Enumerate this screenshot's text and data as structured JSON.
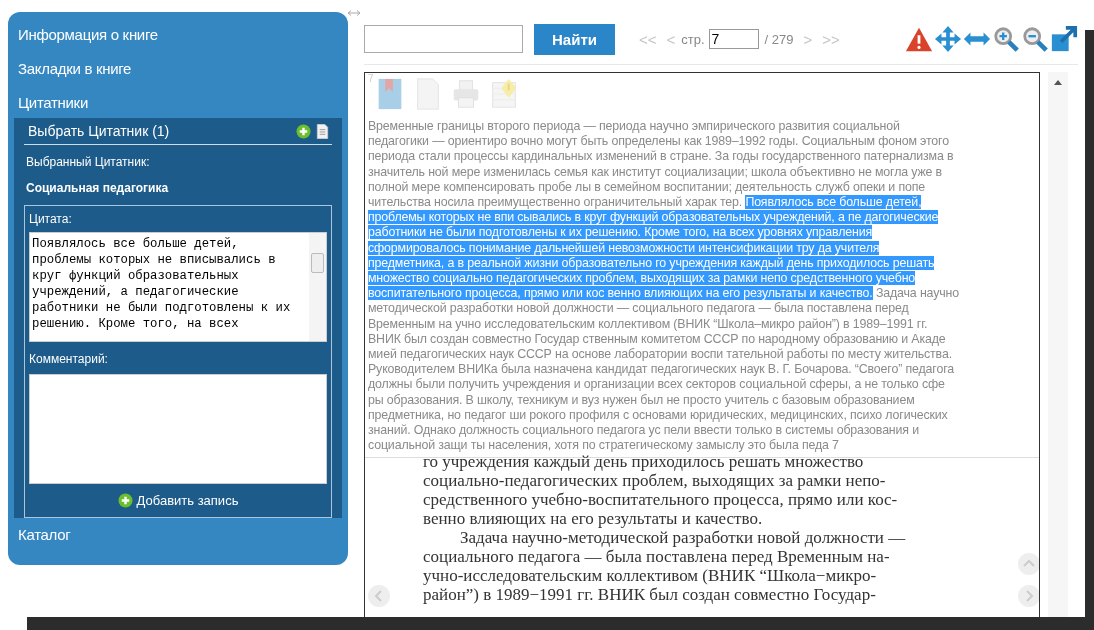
{
  "sidebar": {
    "items": [
      {
        "label": "Информация о книге",
        "expanded": false
      },
      {
        "label": "Закладки в книге",
        "expanded": false
      },
      {
        "label": "Цитатники",
        "expanded": true
      },
      {
        "label": "Каталог",
        "expanded": false
      }
    ],
    "quotebooks": {
      "header": "Выбрать Цитатник (1)",
      "selected_label": "Выбранный Цитатник:",
      "selected_name": "Социальная педагогика",
      "quote_label": "Цитата:",
      "quote_value": "Появлялось все больше детей, проблемы которых не вписывались в круг функций образовательных учреждений, а педагогические работники не были подготовлены к их решению. Кроме того, на всех",
      "comment_label": "Комментарий:",
      "add_button": "Добавить запись"
    }
  },
  "toolbar": {
    "search_button": "Найти",
    "first": "<<",
    "prev": "<",
    "page_label": "стр.",
    "page_value": "7",
    "page_total": "/ 279",
    "next": ">",
    "last": ">>"
  },
  "viewer": {
    "page_number": "7",
    "text_layer": [
      [
        {
          "text": "Временные границы второго периода — периода научно эмпирического развития социальной",
          "selected": false
        }
      ],
      [
        {
          "text": "педагогики — ориентиро вочно могут быть определены как 1989–1992 годы. Социальным фоном этого",
          "selected": false
        }
      ],
      [
        {
          "text": "периода стали процессы кардинальных изменений в стране. За годы государственного патернализма в",
          "selected": false
        }
      ],
      [
        {
          "text": "значитель ной мере изменилась семья как институт социализации; школа объективно не могла уже в",
          "selected": false
        }
      ],
      [
        {
          "text": "полной мере компенсировать пробе лы в семейном воспитании; деятельность служб опеки и попе",
          "selected": false
        }
      ],
      [
        {
          "text": "чительства носила преимущественно ограничительный харак тер.",
          "selected": false
        },
        {
          "text": "Появлялось все больше детей,",
          "selected": true
        }
      ],
      [
        {
          "text": "проблемы которых не впи сывались в круг функций образовательных учреждений, а пе дагогические",
          "selected": true
        }
      ],
      [
        {
          "text": "работники не были подготовлены к их решению. Кроме того, на всех уровнях управления",
          "selected": true
        }
      ],
      [
        {
          "text": "сформировалось понимание дальнейшей невозможности интенсификации тру да учителя",
          "selected": true
        }
      ],
      [
        {
          "text": "предметника, а в реальной жизни образовательно го учреждения каждый день приходилось решать",
          "selected": true
        }
      ],
      [
        {
          "text": "множество социально педагогических проблем, выходящих за рамки непо средственного учебно",
          "selected": true
        }
      ],
      [
        {
          "text": "воспитательного процесса, прямо или кос венно влияющих на его результаты и качество.",
          "selected": true
        },
        {
          "text": "Задача научно",
          "selected": false
        }
      ],
      [
        {
          "text": "методической разработки новой должности — социального педагога — была поставлена перед",
          "selected": false
        }
      ],
      [
        {
          "text": "Временным на учно исследовательским коллективом (ВНИК “Школа–микро район”) в 1989–1991 гг.",
          "selected": false
        }
      ],
      [
        {
          "text": "ВНИК был создан совместно Государ ственным комитетом СССР по народному образованию и Акаде",
          "selected": false
        }
      ],
      [
        {
          "text": "мией педагогических наук СССР на основе лаборатории воспи тательной работы по месту жительства.",
          "selected": false
        }
      ],
      [
        {
          "text": "Руководителем ВНИКа была назначена кандидат педагогических наук В. Г. Бочарова. “Своего” педагога",
          "selected": false
        }
      ],
      [
        {
          "text": "должны были получить учреждения и организации всех секторов социальной сферы, а не только сфе",
          "selected": false
        }
      ],
      [
        {
          "text": "ры образования. В школу, техникум и вуз нужен был не просто учитель с базовым образованием",
          "selected": false
        }
      ],
      [
        {
          "text": "предметника, но педагог ши рокого профиля с основами юридических, медицинских, психо логических",
          "selected": false
        }
      ],
      [
        {
          "text": "знаний. Однако должность социального педагога ус пели ввести только в системы образования и",
          "selected": false
        }
      ],
      [
        {
          "text": "социальной защи ты населения, хотя по стратегическому замыслу это была педа 7",
          "selected": false
        }
      ]
    ],
    "scan_lines": [
      {
        "text": "го учреждения каждый день приходилось решать множество",
        "indent": false
      },
      {
        "text": "социально-педагогических проблем, выходящих за рамки непо-",
        "indent": false
      },
      {
        "text": "средственного учебно-воспитательного процесса, прямо или кос-",
        "indent": false
      },
      {
        "text": "венно влияющих на его результаты и качество.",
        "indent": false
      },
      {
        "text": "Задача научно-методической разработки новой должности —",
        "indent": true
      },
      {
        "text": "социального педагога — была поставлена перед Временным на-",
        "indent": false
      },
      {
        "text": "учно-исследовательским коллективом (ВНИК “Школа−микро-",
        "indent": false
      },
      {
        "text": "район”) в 1989−1991 гг. ВНИК был создан совместно Государ-",
        "indent": false
      }
    ]
  }
}
